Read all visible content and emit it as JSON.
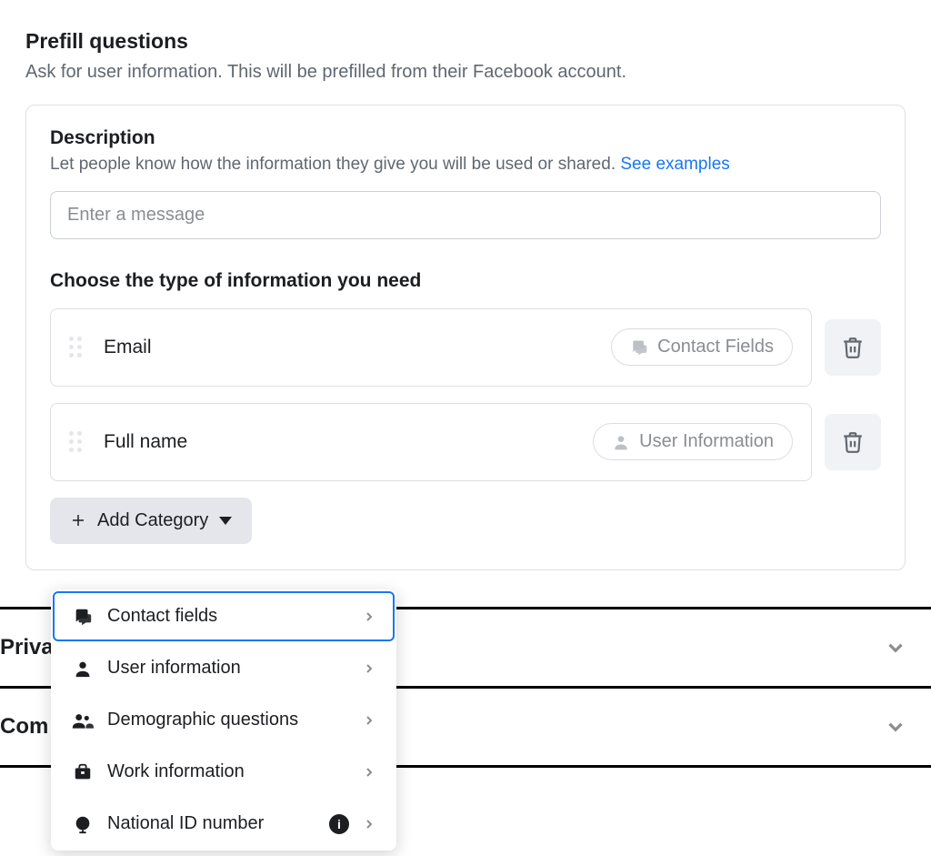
{
  "header": {
    "title": "Prefill questions",
    "subtitle": "Ask for user information. This will be prefilled from their Facebook account."
  },
  "description": {
    "title": "Description",
    "text": "Let people know how the information they give you will be used or shared. ",
    "link_label": "See examples",
    "input_placeholder": "Enter a message"
  },
  "choose_title": "Choose the type of information you need",
  "fields": [
    {
      "label": "Email",
      "pill_label": "Contact Fields",
      "pill_icon": "chat"
    },
    {
      "label": "Full name",
      "pill_label": "User Information",
      "pill_icon": "user"
    }
  ],
  "add_category_label": "Add Category",
  "dropdown": [
    {
      "label": "Contact fields",
      "icon": "chat",
      "selected": true
    },
    {
      "label": "User information",
      "icon": "user",
      "selected": false
    },
    {
      "label": "Demographic questions",
      "icon": "people",
      "selected": false
    },
    {
      "label": "Work information",
      "icon": "briefcase",
      "selected": false
    },
    {
      "label": "National ID number",
      "icon": "globe",
      "selected": false,
      "info": true
    }
  ],
  "collapsed_sections": [
    "Priva",
    "Com"
  ]
}
